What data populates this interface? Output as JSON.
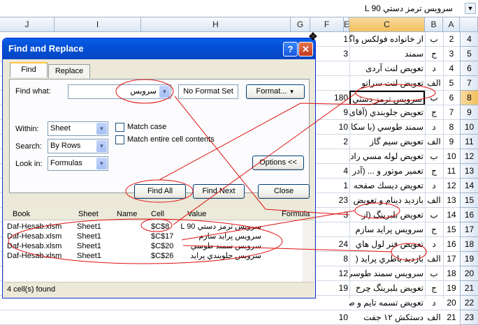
{
  "formula_bar": {
    "value": "سرويس ترمز دستي L 90"
  },
  "columns": {
    "left": [
      {
        "label": "J"
      },
      {
        "label": "I"
      },
      {
        "label": "H"
      },
      {
        "label": "G"
      },
      {
        "label": "F"
      },
      {
        "label": "E"
      }
    ],
    "right": [
      {
        "label": "C"
      },
      {
        "label": "B"
      },
      {
        "label": "A"
      }
    ]
  },
  "rows": [
    {
      "num": "4",
      "a": "2",
      "b": "ب",
      "c": "از خانواده فولكس واگن",
      "e": "1"
    },
    {
      "num": "5",
      "a": "3",
      "b": "ج",
      "c": "سمند",
      "e": "3"
    },
    {
      "num": "6",
      "a": "4",
      "b": "د",
      "c": "تعويض لنت آردی",
      "e": ""
    },
    {
      "num": "7",
      "a": "5",
      "b": "الف",
      "c": "تعويض لنت سراتو",
      "e": ""
    },
    {
      "num": "8",
      "a": "6",
      "b": "ب",
      "c": "سرويس ترمز دستي",
      "e": "180"
    },
    {
      "num": "9",
      "a": "7",
      "b": "ج",
      "c": "تعويض جلوبندي (آقای",
      "e": "9"
    },
    {
      "num": "10",
      "a": "8",
      "b": "د",
      "c": "سمند طوسي (با سكا",
      "e": "10"
    },
    {
      "num": "11",
      "a": "9",
      "b": "الف",
      "c": "تعويض سيم گاز",
      "e": "2"
    },
    {
      "num": "12",
      "a": "10",
      "b": "ب",
      "c": "تعويض لوله مسي رادياتور",
      "e": ""
    },
    {
      "num": "13",
      "a": "11",
      "b": "ج",
      "c": "تعمير موتور و ... (آدر",
      "e": "4"
    },
    {
      "num": "14",
      "a": "12",
      "b": "د",
      "c": "تعويض ديسك صفحه",
      "e": "1"
    },
    {
      "num": "15",
      "a": "13",
      "b": "الف",
      "c": "بازديد دينام و تعويض",
      "e": "23"
    },
    {
      "num": "16",
      "a": "14",
      "b": "ب",
      "c": "تعويض بلبرينگ (از",
      "e": "3"
    },
    {
      "num": "17",
      "a": "15",
      "b": "ج",
      "c": "سرويس پرايد سازم",
      "e": ""
    },
    {
      "num": "18",
      "a": "16",
      "b": "د",
      "c": "تعويض فنر لول هاي",
      "e": "24"
    },
    {
      "num": "19",
      "a": "17",
      "b": "الف",
      "c": "بازديد باطري پرايد (",
      "e": "8"
    },
    {
      "num": "20",
      "a": "18",
      "b": "ب",
      "c": "سرويس سمند طوسي",
      "e": "12"
    },
    {
      "num": "21",
      "a": "19",
      "b": "ج",
      "c": "تعويض بلبرينگ چرخ",
      "e": "19"
    },
    {
      "num": "22",
      "a": "20",
      "b": "د",
      "c": "تعويض تسمه تايم و صافي (راد",
      "e": ""
    },
    {
      "num": "23",
      "a": "21",
      "b": "الف",
      "c": "دستكش ۱۲ جفت",
      "e": "10"
    }
  ],
  "dialog": {
    "title": "Find and Replace",
    "help_label": "?",
    "close_label": "✕",
    "tabs": [
      "Find",
      "Replace"
    ],
    "find_what_label": "Find what:",
    "find_what_value": "سرويس",
    "format_status": "No Format Set",
    "format_button": "Format...",
    "within_label": "Within:",
    "within_value": "Sheet",
    "search_label": "Search:",
    "search_value": "By Rows",
    "lookin_label": "Look in:",
    "lookin_value": "Formulas",
    "match_case_label": "Match case",
    "match_entire_label": "Match entire cell contents",
    "options_button": "Options <<",
    "find_all_button": "Find All",
    "find_next_button": "Find Next",
    "close_button": "Close",
    "results_headers": {
      "book": "Book",
      "sheet": "Sheet",
      "name": "Name",
      "cell": "Cell",
      "value": "Value",
      "formula": "Formula"
    },
    "results": [
      {
        "book": "Daf-Hesab.xlsm",
        "sheet": "Sheet1",
        "cell": "$C$8",
        "value": "سرويس ترمز دستي L 90"
      },
      {
        "book": "Daf-Hesab.xlsm",
        "sheet": "Sheet1",
        "cell": "$C$17",
        "value": "سرويس پرايد سازم"
      },
      {
        "book": "Daf-Hesab.xlsm",
        "sheet": "Sheet1",
        "cell": "$C$20",
        "value": "سرويس سمند طوسي"
      },
      {
        "book": "Daf-Hesab.xlsm",
        "sheet": "Sheet1",
        "cell": "$C$26",
        "value": "سرويس جلوبندي پرايد"
      }
    ],
    "status": "4 cell(s) found"
  },
  "colors": {
    "annotation": "#e01010",
    "title_bar": "#0a5ee8",
    "selected_header": "#f1c15f"
  }
}
